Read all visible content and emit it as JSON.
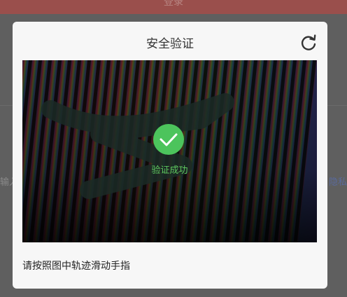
{
  "background": {
    "header_text": "登录",
    "left_partial_text": "输入",
    "right_partial_text": "户隐私"
  },
  "dialog": {
    "title": "安全验证",
    "refresh_icon": "refresh-icon",
    "success_text": "验证成功",
    "instruction": "请按照图中轨迹滑动手指"
  },
  "colors": {
    "success_green": "#4cc45c",
    "dialog_bg": "#f7f7f7",
    "overlay": "#5f5f5f"
  }
}
